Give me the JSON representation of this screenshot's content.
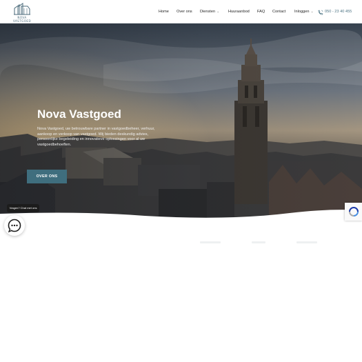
{
  "brand": {
    "name": "NOVA VASTGOED",
    "logo_icon": "building-logo-icon"
  },
  "nav": {
    "items": [
      {
        "label": "Home"
      },
      {
        "label": "Over ons"
      },
      {
        "label": "Diensten",
        "dropdown": true
      },
      {
        "label": "Huuraanbod"
      },
      {
        "label": "FAQ"
      },
      {
        "label": "Contact"
      },
      {
        "label": "Inloggen",
        "dropdown": true
      }
    ],
    "phone": "050 - 23 40 455",
    "phone_icon": "phone-icon"
  },
  "hero": {
    "title": "Nova Vastgoed",
    "text": "Nova Vastgoed, uw betrouwbare partner in vastgoedbeheer, verhuur, aankoop en verkoop van vastgoed. Wij bieden deskundig advies, persoonlijke begeleiding en innovatieve oplossingen voor al uw vastgoedbehoeften.",
    "button": "OVER ONS"
  },
  "chat": {
    "tooltip": "Vragen? Chat met ons",
    "icon": "chat-bubble-icon"
  },
  "recaptcha": {
    "icon": "recaptcha-icon"
  },
  "colors": {
    "accent": "#3f6e7e",
    "phone": "#4e7585",
    "text": "#1f1f1f"
  }
}
